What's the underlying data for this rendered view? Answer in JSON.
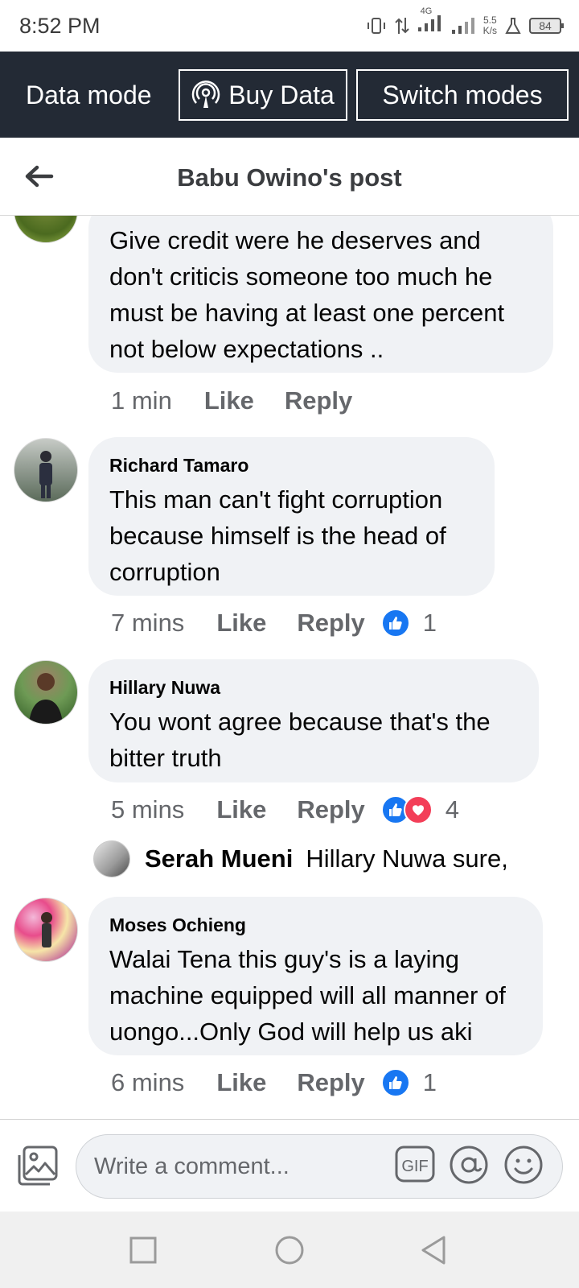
{
  "status_bar": {
    "time": "8:52 PM",
    "network": "4G",
    "speed_value": "5.5",
    "speed_unit": "K/s",
    "battery": "84"
  },
  "data_bar": {
    "mode_label": "Data mode",
    "buy_data_label": "Buy Data",
    "switch_modes_label": "Switch modes"
  },
  "header": {
    "title": "Babu Owino's post"
  },
  "comments": [
    {
      "author": "",
      "text": "Give credit were he deserves and don't criticis  someone too much he must be having  at least one percent  not below expectations ..",
      "time": "1 min",
      "like": "Like",
      "reply": "Reply",
      "reactions": null
    },
    {
      "author": "Richard Tamaro",
      "text": "This man can't fight corruption because himself is the head of corruption",
      "time": "7 mins",
      "like": "Like",
      "reply": "Reply",
      "reactions": {
        "types": [
          "like"
        ],
        "count": "1"
      }
    },
    {
      "author": "Hillary Nuwa",
      "text": "You wont agree because that's the bitter truth",
      "time": "5 mins",
      "like": "Like",
      "reply": "Reply",
      "reactions": {
        "types": [
          "like",
          "love"
        ],
        "count": "4"
      },
      "reply_preview": {
        "author": "Serah Mueni",
        "text": "Hillary Nuwa sure,"
      }
    },
    {
      "author": "Moses Ochieng",
      "text": "Walai Tena this guy's is a laying machine equipped will all manner of uongo...Only God will help us aki",
      "time": "6 mins",
      "like": "Like",
      "reply": "Reply",
      "reactions": {
        "types": [
          "like"
        ],
        "count": "1"
      }
    }
  ],
  "composer": {
    "placeholder": "Write a comment...",
    "gif_label": "GIF"
  },
  "colors": {
    "data_bar_bg": "#232a35",
    "bubble_bg": "#f0f2f5",
    "like_blue": "#1877f2",
    "love_red": "#f33e58",
    "meta_gray": "#65676b"
  },
  "icons": {
    "back": "arrow-left-icon",
    "buy_data": "broadcast-icon",
    "photo": "photo-icon",
    "gif": "gif-icon",
    "mention": "at-icon",
    "emoji": "emoji-icon"
  }
}
